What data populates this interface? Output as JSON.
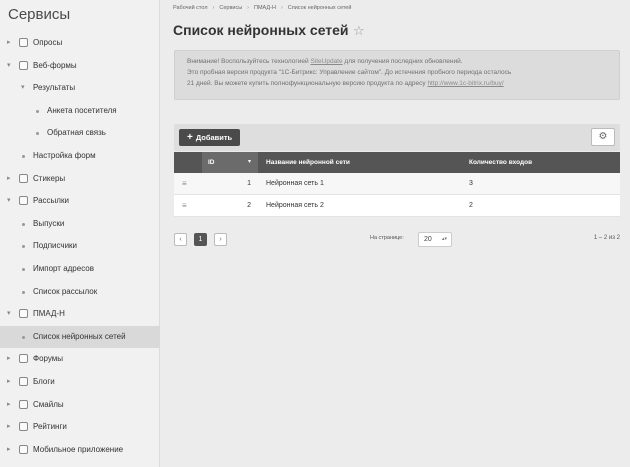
{
  "sidebar": {
    "title": "Сервисы",
    "items": [
      {
        "label": "Опросы",
        "level": 0,
        "arrow": "▸"
      },
      {
        "label": "Веб-формы",
        "level": 0,
        "arrow": "▾"
      },
      {
        "label": "Результаты",
        "level": 1,
        "arrow": "▾"
      },
      {
        "label": "Анкета посетителя",
        "level": 2
      },
      {
        "label": "Обратная связь",
        "level": 2
      },
      {
        "label": "Настройка форм",
        "level": 1
      },
      {
        "label": "Стикеры",
        "level": 0,
        "arrow": "▸"
      },
      {
        "label": "Рассылки",
        "level": 0,
        "arrow": "▾"
      },
      {
        "label": "Выпуски",
        "level": 1
      },
      {
        "label": "Подписчики",
        "level": 1
      },
      {
        "label": "Импорт адресов",
        "level": 1
      },
      {
        "label": "Список рассылок",
        "level": 1
      },
      {
        "label": "ПМАД-Н",
        "level": 0,
        "arrow": "▾"
      },
      {
        "label": "Список нейронных сетей",
        "level": 1,
        "active": true
      },
      {
        "label": "Форумы",
        "level": 0,
        "arrow": "▸"
      },
      {
        "label": "Блоги",
        "level": 0,
        "arrow": "▸"
      },
      {
        "label": "Смайлы",
        "level": 0,
        "arrow": "▸"
      },
      {
        "label": "Рейтинги",
        "level": 0,
        "arrow": "▸"
      },
      {
        "label": "Мобильное приложение",
        "level": 0,
        "arrow": "▸"
      }
    ]
  },
  "breadcrumb": [
    "Рабочий стол",
    "Сервисы",
    "ПМАД-Н",
    "Список нейронных сетей"
  ],
  "page": {
    "title": "Список нейронных сетей",
    "star": "☆"
  },
  "notice": {
    "line1_a": "Внимание! Воспользуйтесь технологией ",
    "line1_link": "SiteUpdate",
    "line1_b": " для получения последних обновлений.",
    "line2": "Это пробная версия продукта \"1С-Битрикс: Управление сайтом\". До истечения пробного периода осталось",
    "line3_a": "21 дней. Вы можете купить полнофункциональную версию продукта по адресу ",
    "line3_link": "http://www.1c-bitrix.ru/buy/"
  },
  "toolbar": {
    "add_label": "Добавить",
    "add_icon": "+",
    "settings_icon": "⚙"
  },
  "grid": {
    "columns": {
      "id": "ID",
      "name": "Название нейронной сети",
      "inputs": "Количество входов"
    },
    "sort_indicator": "▾",
    "rows": [
      {
        "id": "1",
        "name": "Нейронная сеть 1",
        "inputs": "3"
      },
      {
        "id": "2",
        "name": "Нейронная сеть 2",
        "inputs": "2"
      }
    ]
  },
  "pager": {
    "prev": "‹",
    "current": "1",
    "next": "›",
    "per_page_label": "На странице:",
    "per_page_value": "20",
    "records": "1 – 2 из 2"
  }
}
